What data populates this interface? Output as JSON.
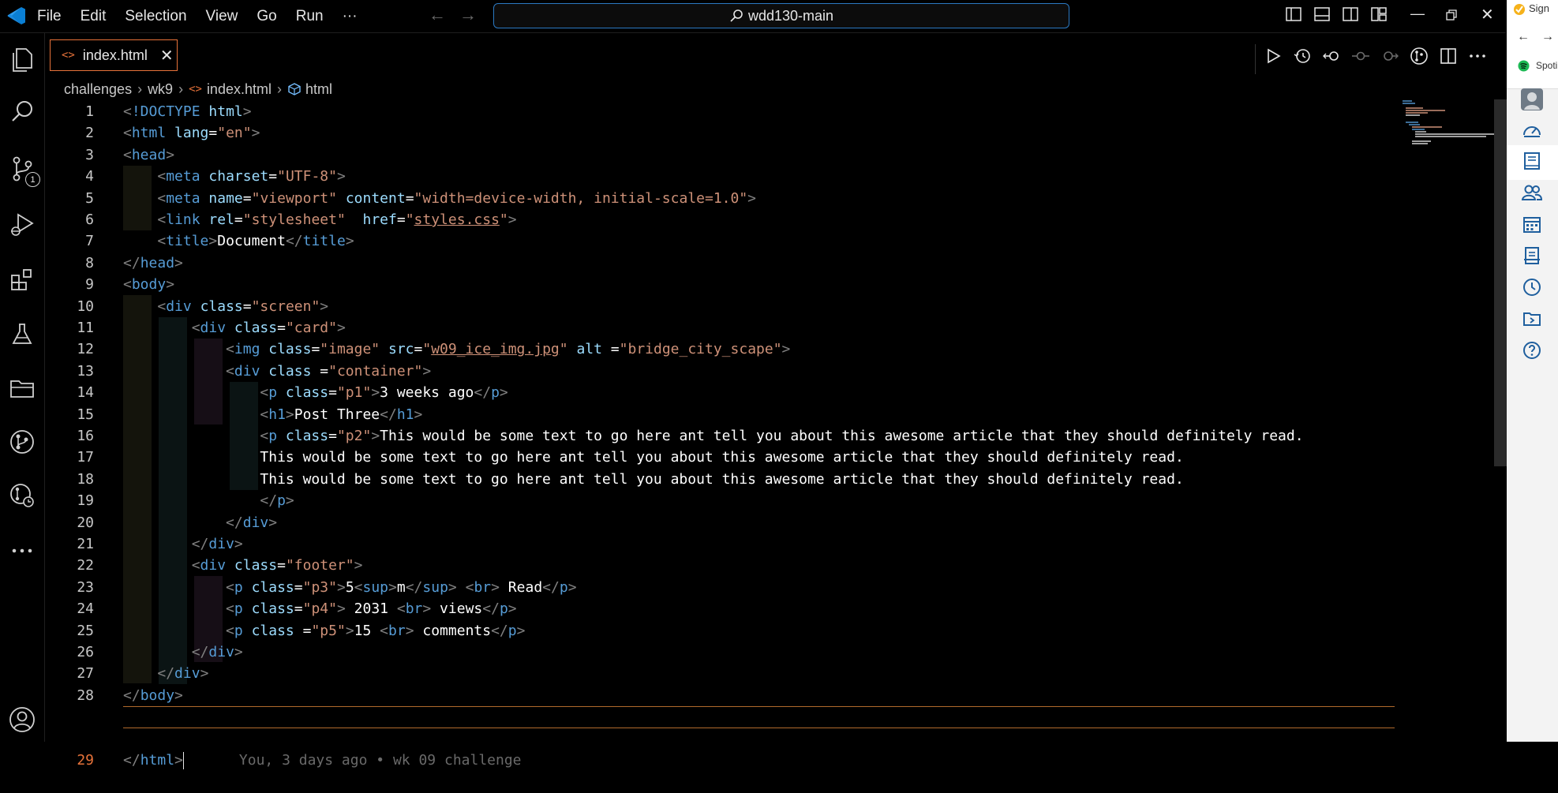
{
  "titlebar": {
    "menu": [
      "File",
      "Edit",
      "Selection",
      "View",
      "Go",
      "Run",
      "···"
    ],
    "search": "wdd130-main"
  },
  "activity_bar": {
    "source_control_badge": "1"
  },
  "tabs": [
    {
      "label": "index.html"
    }
  ],
  "breadcrumb": [
    "challenges",
    "wk9",
    "index.html",
    "html"
  ],
  "editor": {
    "lines": [
      "1",
      "2",
      "3",
      "4",
      "5",
      "6",
      "7",
      "8",
      "9",
      "10",
      "11",
      "12",
      "13",
      "14",
      "15",
      "16",
      "17",
      "18",
      "19",
      "20",
      "21",
      "22",
      "23",
      "24",
      "25",
      "26",
      "27",
      "28",
      "29"
    ],
    "blame": "You, 3 days ago • wk 09 challenge",
    "t": {
      "doctype": "!DOCTYPE",
      "html": "html",
      "lang": "lang",
      "en": "\"en\"",
      "head": "head",
      "meta": "meta",
      "charset": "charset",
      "utf8": "\"UTF-8\"",
      "name": "name",
      "viewport": "\"viewport\"",
      "content": "content",
      "content_val": "\"width=device-width, initial-scale=1.0\"",
      "link": "link",
      "rel": "rel",
      "stylesheet": "\"stylesheet\"",
      "href": "href",
      "styles_css": "styles.css",
      "title": "title",
      "document": "Document",
      "body": "body",
      "div": "div",
      "class": "class",
      "screen": "\"screen\"",
      "card": "\"card\"",
      "img": "img",
      "image": "\"image\"",
      "src": "src",
      "img_file": "w09_ice_img.jpg",
      "alt": "alt",
      "alt_val": "\"bridge_city_scape\"",
      "container": "\"container\"",
      "p": "p",
      "p1": "\"p1\"",
      "weeks": "3 weeks ago",
      "h1": "h1",
      "post_three": "Post Three",
      "p2": "\"p2\"",
      "article": "This would be some text to go here ant tell you about this awesome article that they should definitely read.",
      "footer": "\"footer\"",
      "p3": "\"p3\"",
      "five": "5",
      "sup": "sup",
      "m": "m",
      "br": "br",
      "read": " Read",
      "p4": "\"p4\"",
      "views_num": " 2031 ",
      "views": " views",
      "p5": "\"p5\"",
      "fifteen": "15 ",
      "comments": " comments"
    }
  },
  "right_panel": {
    "top_label_1": "Sign",
    "top_label_2": "Spoti"
  },
  "colors": {
    "tag": "#569cd6",
    "attr": "#9cdcfe",
    "string": "#ce9178",
    "bracket": "#808080",
    "accent_orange": "#e8733a"
  }
}
